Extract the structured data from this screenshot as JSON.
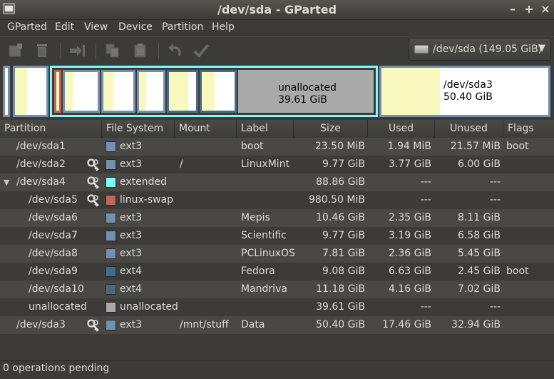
{
  "window": {
    "title": "/dev/sda - GParted",
    "min_label": "–",
    "max_label": "+",
    "close_label": "×"
  },
  "menu": [
    "GParted",
    "Edit",
    "View",
    "Device",
    "Partition",
    "Help"
  ],
  "toolbar": {
    "icons": [
      "new-icon",
      "delete-icon",
      "resize-move-icon",
      "copy-icon",
      "paste-icon",
      "undo-icon",
      "apply-icon"
    ]
  },
  "device_selector": {
    "value": "/dev/sda  (149.05 GiB)",
    "arrow": "▼"
  },
  "disk_map": {
    "unallocated": {
      "name": "unallocated",
      "size": "39.61 GiB"
    },
    "sda3": {
      "name": "/dev/sda3",
      "size": "50.40 GiB"
    }
  },
  "table": {
    "columns": [
      "Partition",
      "File System",
      "Mount Point",
      "Label",
      "Size",
      "Used",
      "Unused",
      "Flags"
    ],
    "rows": [
      {
        "partition": "/dev/sda1",
        "indent": 1,
        "key": false,
        "fs": "ext3",
        "fs_color": "#7590ae",
        "mount": "",
        "label": "boot",
        "size": "23.50 MiB",
        "used": "1.94 MiB",
        "unused": "21.57 MiB",
        "flags": "boot"
      },
      {
        "partition": "/dev/sda2",
        "indent": 1,
        "key": true,
        "fs": "ext3",
        "fs_color": "#7590ae",
        "mount": "/",
        "label": "LinuxMint",
        "size": "9.77 GiB",
        "used": "3.77 GiB",
        "unused": "6.00 GiB",
        "flags": ""
      },
      {
        "partition": "/dev/sda4",
        "indent": 1,
        "key": true,
        "expander": "▼",
        "fs": "extended",
        "fs_color": "#7dfcfe",
        "mount": "",
        "label": "",
        "size": "88.86 GiB",
        "used": "---",
        "unused": "---",
        "flags": ""
      },
      {
        "partition": "/dev/sda5",
        "indent": 2,
        "key": true,
        "fs": "linux-swap",
        "fs_color": "#c1665a",
        "mount": "",
        "label": "",
        "size": "980.50 MiB",
        "used": "---",
        "unused": "---",
        "flags": ""
      },
      {
        "partition": "/dev/sda6",
        "indent": 2,
        "key": false,
        "fs": "ext3",
        "fs_color": "#7590ae",
        "mount": "",
        "label": "Mepis",
        "size": "10.46 GiB",
        "used": "2.35 GiB",
        "unused": "8.11 GiB",
        "flags": ""
      },
      {
        "partition": "/dev/sda7",
        "indent": 2,
        "key": false,
        "fs": "ext3",
        "fs_color": "#7590ae",
        "mount": "",
        "label": "Scientific",
        "size": "9.77 GiB",
        "used": "3.19 GiB",
        "unused": "6.58 GiB",
        "flags": ""
      },
      {
        "partition": "/dev/sda8",
        "indent": 2,
        "key": false,
        "fs": "ext3",
        "fs_color": "#7590ae",
        "mount": "",
        "label": "PCLinuxOS",
        "size": "7.81 GiB",
        "used": "2.36 GiB",
        "unused": "5.45 GiB",
        "flags": ""
      },
      {
        "partition": "/dev/sda9",
        "indent": 2,
        "key": false,
        "fs": "ext4",
        "fs_color": "#4b6983",
        "mount": "",
        "label": "Fedora",
        "size": "9.08 GiB",
        "used": "6.63 GiB",
        "unused": "2.45 GiB",
        "flags": "boot"
      },
      {
        "partition": "/dev/sda10",
        "indent": 2,
        "key": false,
        "fs": "ext4",
        "fs_color": "#4b6983",
        "mount": "",
        "label": "Mandriva",
        "size": "11.18 GiB",
        "used": "4.16 GiB",
        "unused": "7.02 GiB",
        "flags": ""
      },
      {
        "partition": "unallocated",
        "indent": 2,
        "key": false,
        "fs": "unallocated",
        "fs_color": "#a9a9a9",
        "mount": "",
        "label": "",
        "size": "39.61 GiB",
        "used": "---",
        "unused": "---",
        "flags": ""
      },
      {
        "partition": "/dev/sda3",
        "indent": 1,
        "key": true,
        "fs": "ext3",
        "fs_color": "#7590ae",
        "mount": "/mnt/stuff",
        "label": "Data",
        "size": "50.40 GiB",
        "used": "17.46 GiB",
        "unused": "32.94 GiB",
        "flags": ""
      }
    ]
  },
  "status": "0 operations pending",
  "colors": {
    "background": "#3c3b37",
    "extended_border": "#7dfcfe",
    "used_space": "#f8f8bf",
    "unallocated": "#a9a9a9",
    "ext3": "#7590ae",
    "ext4": "#4b6983",
    "swap": "#c1665a"
  }
}
